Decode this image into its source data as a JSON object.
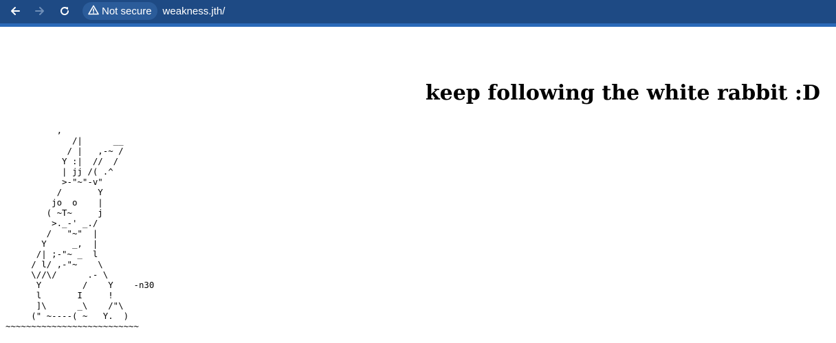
{
  "browser": {
    "back_icon": "arrow-left-icon",
    "forward_icon": "arrow-right-icon",
    "reload_icon": "reload-icon",
    "security_icon": "warning-triangle-icon",
    "security_label": "Not secure",
    "url": "weakness.jth/",
    "colors": {
      "toolbar": "#1e4a84",
      "toolbar_border": "#2a69b8",
      "chip": "#2b5c9a"
    }
  },
  "page": {
    "heading": "keep following the white rabbit :D",
    "ascii_art": "          ,\n             /|      __\n            / |   ,-~ /\n           Y :|  //  /\n           | jj /( .^\n           >-\"~\"-v\"\n          /       Y\n         jo  o    |\n        ( ~T~     j\n         >._-' _./\n        /   \"~\"  |\n       Y     _,  |\n      /| ;-\"~ _  l\n     / l/ ,-\"~    \\\n     \\//\\/      .- \\\n      Y        /    Y    -n30\n      l       I     !\n      ]\\      _\\    /\"\\\n     (\" ~----( ~   Y.  )\n~~~~~~~~~~~~~~~~~~~~~~~~~~"
  }
}
